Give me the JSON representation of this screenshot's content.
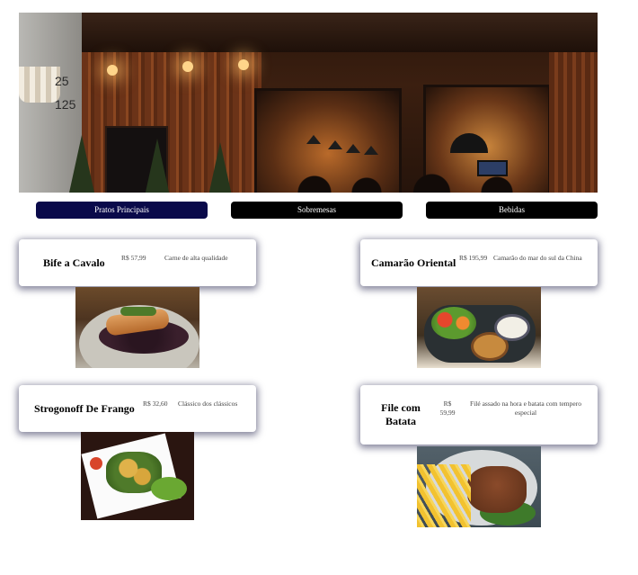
{
  "hero": {
    "house_numbers": [
      "25",
      "125"
    ]
  },
  "tabs": [
    {
      "label": "Pratos Principais",
      "active": true
    },
    {
      "label": "Sobremesas",
      "active": false
    },
    {
      "label": "Bebidas",
      "active": false
    }
  ],
  "menu": [
    {
      "name": "Bife a Cavalo",
      "price": "R$ 57,99",
      "description": "Carne de alta qualidade",
      "photo": "steak-with-egg-on-black-rice"
    },
    {
      "name": "Camarão Oriental",
      "price": "R$ 195,99",
      "description": "Camarão do mar do sul da China",
      "photo": "shrimp-board-with-sides"
    },
    {
      "name": "Strogonoff De Frango",
      "price": "R$ 32,60",
      "description": "Clássico dos clássicos",
      "photo": "chicken-strogonoff-plate"
    },
    {
      "name": "File com Batata",
      "price": "R$ 59,99",
      "description": "Filé assado na hora e batata com tempero especial",
      "photo": "steak-with-fries"
    }
  ],
  "colors": {
    "tab_bg": "#000000",
    "tab_active_bg": "#0a0a4a",
    "tab_text": "#ffffff",
    "card_shadow": "#282850"
  }
}
